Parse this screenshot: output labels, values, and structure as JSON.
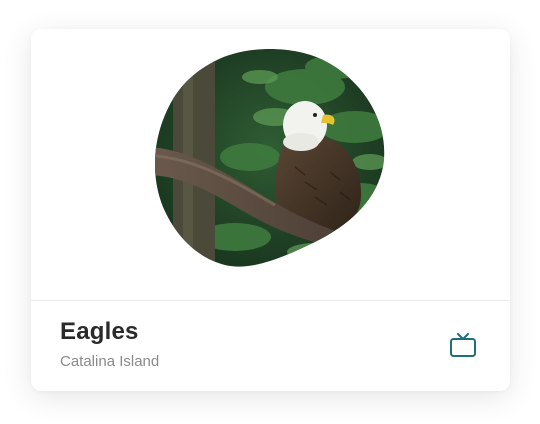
{
  "card": {
    "title": "Eagles",
    "subtitle": "Catalina Island",
    "action_icon": "tv-icon"
  },
  "colors": {
    "accent": "#1d6f7a",
    "title": "#2a2a2a",
    "subtitle": "#8a8a8a"
  }
}
